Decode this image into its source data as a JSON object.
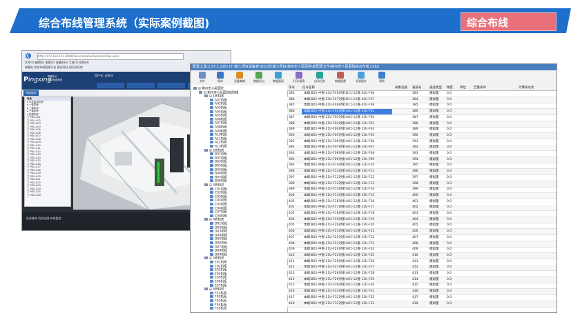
{
  "slide": {
    "title": "综合布线管理系统（实际案例截图)",
    "tag": "综合布线",
    "colors": {
      "banner": "#1d6fcb",
      "tag": "#e9707a"
    }
  },
  "browser": {
    "address": "http://172.168.10.1:8080/Generalcable/GeneralIndex.aspx",
    "menu": "文件(F)   编辑(E)   查看(V)   收藏夹(A)   工具(T)   帮助(H)",
    "favorites": "收藏夹   综合布线管理平台   建议网站   网页快讯库",
    "logo": "ingxing",
    "logo_sub": [
      "数据中心",
      "综合布线系统"
    ],
    "user": "用户名: admin",
    "active_tab": "布线监控",
    "sidebar_items": [
      "设备",
      "中央监控机房",
      "一楼机房",
      "二楼机房",
      "三楼机房",
      "四楼机房",
      "PDU-A01",
      "PDU-A02",
      "PDU-A03",
      "PDU-A04",
      "PDU-A05",
      "PDU-A06",
      "PDU-A07",
      "PDU-A08",
      "PDU-A09",
      "PDU-A10",
      "PDU-A11",
      "PDU-A12",
      "PDU-A13",
      "PDU-A14",
      "PDU-A15",
      "PDU-A16",
      "PDU-A17",
      "PDU-A18",
      "PDU-A19",
      "PDU-A20",
      "PDU-A21",
      "PDU-A22",
      "PDU-A23",
      "PDU-A24",
      "PDU-A25",
      "PDU-A26"
    ],
    "status": "信息查询    机房运维    布线监控"
  },
  "tool": {
    "title": "配置工具(2.27.1.226)  [E:\\施工项目设备表\\2022年施工项目\\柳州市人民医院\\新配置文件\\柳州市人民医院综合布线.mdb]",
    "toolbar": [
      "文件",
      "保存",
      "设备编辑",
      "数据导出",
      "数据图表",
      "打印/报表",
      "自动识别",
      "数据配置",
      "资源图片",
      "帮助"
    ],
    "tree": [
      "柳州市人民医院",
      "柳州市人民医院住院楼",
      "1栋机房",
      "A01机柜",
      "A02机柜",
      "A03机柜",
      "A04机柜",
      "A05机柜",
      "A06机柜",
      "A07机柜",
      "A08机柜",
      "A09机柜",
      "A10机柜",
      "A11机柜",
      "A12机柜",
      "A13机柜",
      "2栋机房",
      "B01机柜",
      "B02机柜",
      "B03机柜",
      "B04机柜",
      "B05机柜",
      "B06机柜",
      "B07机柜",
      "B08机柜",
      "3栋机房",
      "C01机柜",
      "C02机柜",
      "C03机柜",
      "C04机柜",
      "C05机柜",
      "C06机柜",
      "C07机柜",
      "C08机柜",
      "4栋机房",
      "D01机柜",
      "D02机柜",
      "D03机柜",
      "D04机柜",
      "D05机柜",
      "D06机柜",
      "D07机柜",
      "D08机柜",
      "D09机柜",
      "5栋机房",
      "E01机柜",
      "E02机柜",
      "E03机柜",
      "E04机柜",
      "E05机柜",
      "E06机柜",
      "E07机柜",
      "6栋机房",
      "F01机柜",
      "F02机柜",
      "F03机柜",
      "F04机柜",
      "F05机柜"
    ],
    "columns": [
      "序号",
      "信号名称",
      "采集设备",
      "通道号",
      "通道类型",
      "精度",
      "单位",
      "告警条件",
      "计算表达式"
    ],
    "rows": [
      [
        "383",
        "本端:B01-中盘-23U-F46对接:B11-12盘-42U-F46",
        "383",
        "模拟量",
        "0.0"
      ],
      [
        "384",
        "本端:B01-中盘-23U-F47对接:B11-12盘-42U-F47",
        "384",
        "模拟量",
        "0.0"
      ],
      [
        "385",
        "本端:B01-中盘-23U-F48对接:B11-12盘-42U-F48",
        "385",
        "模拟量",
        "0.0"
      ],
      [
        "386",
        "本端:B01-中盘-21U-F01对接:A01-12盘-13U-F01",
        "386",
        "模拟量",
        "0.0"
      ],
      [
        "387",
        "本端:B01-中盘-21U-F02对接:A01-12盘-13U-F02",
        "387",
        "模拟量",
        "0.0"
      ],
      [
        "388",
        "本端:B01-中盘-21U-F03对接:A01-12盘-13U-F03",
        "388",
        "模拟量",
        "0.0"
      ],
      [
        "389",
        "本端:B01-中盘-21U-F04对接:A01-12盘-13U-F04",
        "389",
        "模拟量",
        "0.0"
      ],
      [
        "390",
        "本端:B01-中盘-21U-F05对接:A01-12盘-13U-F05",
        "390",
        "模拟量",
        "0.0"
      ],
      [
        "391",
        "本端:B01-中盘-21U-F06对接:A01-12盘-13U-F06",
        "391",
        "模拟量",
        "0.0"
      ],
      [
        "392",
        "本端:B01-中盘-21U-F07对接:A01-12盘-13U-F07",
        "392",
        "模拟量",
        "0.0"
      ],
      [
        "393",
        "本端:B01-中盘-21U-F08对接:A01-12盘-13U-F08",
        "393",
        "模拟量",
        "0.0"
      ],
      [
        "394",
        "本端:B01-中盘-21U-F09对接:A01-12盘-13U-F09",
        "394",
        "模拟量",
        "0.0"
      ],
      [
        "395",
        "本端:B01-中盘-21U-F10对接:A01-12盘-13U-F10",
        "395",
        "模拟量",
        "0.0"
      ],
      [
        "396",
        "本端:B01-中盘-21U-F11对接:A01-12盘-13U-F11",
        "396",
        "模拟量",
        "0.0"
      ],
      [
        "397",
        "本端:B01-中盘-21U-F12对接:A01-12盘-13U-F12",
        "397",
        "模拟量",
        "0.0"
      ],
      [
        "398",
        "本端:B01-中盘-21U-F13对接:A01-12盘-13U-F13",
        "398",
        "模拟量",
        "0.0"
      ],
      [
        "399",
        "本端:B01-中盘-21U-F14对接:A01-12盘-13U-F14",
        "399",
        "模拟量",
        "0.0"
      ],
      [
        "400",
        "本端:B01-中盘-21U-F15对接:A01-12盘-13U-F15",
        "400",
        "模拟量",
        "0.0"
      ],
      [
        "401",
        "本端:B01-中盘-21U-F16对接:A01-12盘-13U-F16",
        "401",
        "模拟量",
        "0.0"
      ],
      [
        "402",
        "本端:B01-中盘-21U-F17对接:A01-12盘-13U-F17",
        "402",
        "模拟量",
        "0.0"
      ],
      [
        "403",
        "本端:B01-中盘-21U-F18对接:A01-12盘-13U-F18",
        "403",
        "模拟量",
        "0.0"
      ],
      [
        "404",
        "本端:B01-中盘-21U-F19对接:A01-12盘-13U-F19",
        "404",
        "模拟量",
        "0.0"
      ],
      [
        "405",
        "本端:B01-中盘-21U-F20对接:A01-12盘-13U-F20",
        "405",
        "模拟量",
        "0.0"
      ],
      [
        "406",
        "本端:B01-中盘-21U-F21对接:A01-12盘-13U-F21",
        "406",
        "模拟量",
        "0.0"
      ],
      [
        "407",
        "本端:B01-中盘-21U-F22对接:A01-12盘-13U-F22",
        "407",
        "模拟量",
        "0.0"
      ],
      [
        "408",
        "本端:B01-中盘-21U-F23对接:A01-12盘-13U-F23",
        "408",
        "模拟量",
        "0.0"
      ],
      [
        "409",
        "本端:B01-中盘-21U-F24对接:A01-12盘-13U-F24",
        "409",
        "模拟量",
        "0.0"
      ],
      [
        "410",
        "本端:B01-中盘-21U-F25对接:A01-12盘-13U-F25",
        "410",
        "模拟量",
        "0.0"
      ],
      [
        "411",
        "本端:B01-中盘-21U-F26对接:A01-12盘-13U-F26",
        "411",
        "模拟量",
        "0.0"
      ],
      [
        "412",
        "本端:B01-中盘-21U-F27对接:A01-12盘-13U-F27",
        "412",
        "模拟量",
        "0.0"
      ],
      [
        "413",
        "本端:B01-中盘-21U-F28对接:A01-12盘-13U-F28",
        "413",
        "模拟量",
        "0.0"
      ],
      [
        "414",
        "本端:B01-中盘-21U-F29对接:A01-12盘-13U-F29",
        "414",
        "模拟量",
        "0.0"
      ],
      [
        "415",
        "本端:B01-中盘-21U-F30对接:A01-12盘-13U-F30",
        "415",
        "模拟量",
        "0.0"
      ],
      [
        "416",
        "本端:B01-中盘-21U-F31对接:A01-12盘-13U-F31",
        "416",
        "模拟量",
        "0.0"
      ],
      [
        "417",
        "本端:B01-中盘-21U-F32对接:A01-12盘-13U-F32",
        "417",
        "模拟量",
        "0.0"
      ],
      [
        "418",
        "本端:B01-中盘-21U-F33对接:A01-12盘-13U-F33",
        "418",
        "模拟量",
        "0.0"
      ]
    ],
    "selected_row": 3
  }
}
